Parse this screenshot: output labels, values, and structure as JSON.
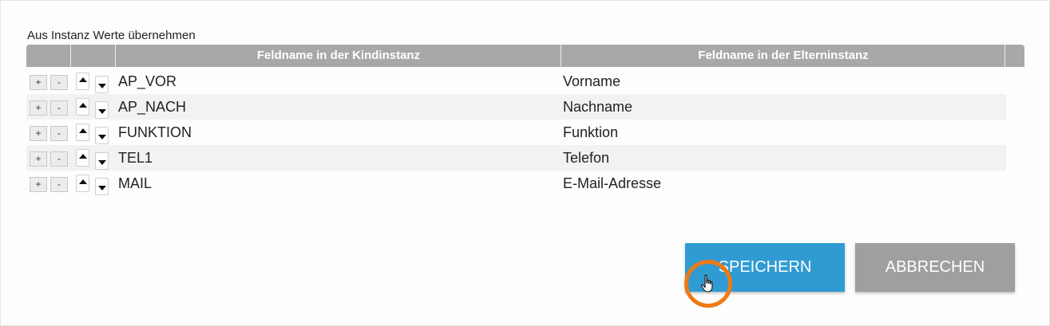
{
  "dialog": {
    "section_title": "Aus Instanz Werte übernehmen"
  },
  "table": {
    "columns": [
      "",
      "",
      "Feldname in der Kindinstanz",
      "Feldname in der Elterninstanz",
      ""
    ],
    "row_buttons": {
      "add": "+",
      "remove": "-"
    },
    "rows": [
      {
        "child": "AP_VOR",
        "parent": "Vorname"
      },
      {
        "child": "AP_NACH",
        "parent": "Nachname"
      },
      {
        "child": "FUNKTION",
        "parent": "Funktion"
      },
      {
        "child": "TEL1",
        "parent": "Telefon"
      },
      {
        "child": "MAIL",
        "parent": "E-Mail-Adresse"
      }
    ]
  },
  "actions": {
    "save_label": "SPEICHERN",
    "cancel_label": "ABBRECHEN"
  },
  "colors": {
    "header": "#a8a8a6",
    "save": "#2f9bd2",
    "cancel": "#9f9f9f",
    "cursor_highlight": "#ee7a16"
  },
  "icons": {
    "move_up": "triangle-up-icon",
    "move_down": "triangle-down-icon",
    "cursor": "hand-pointer-icon"
  }
}
